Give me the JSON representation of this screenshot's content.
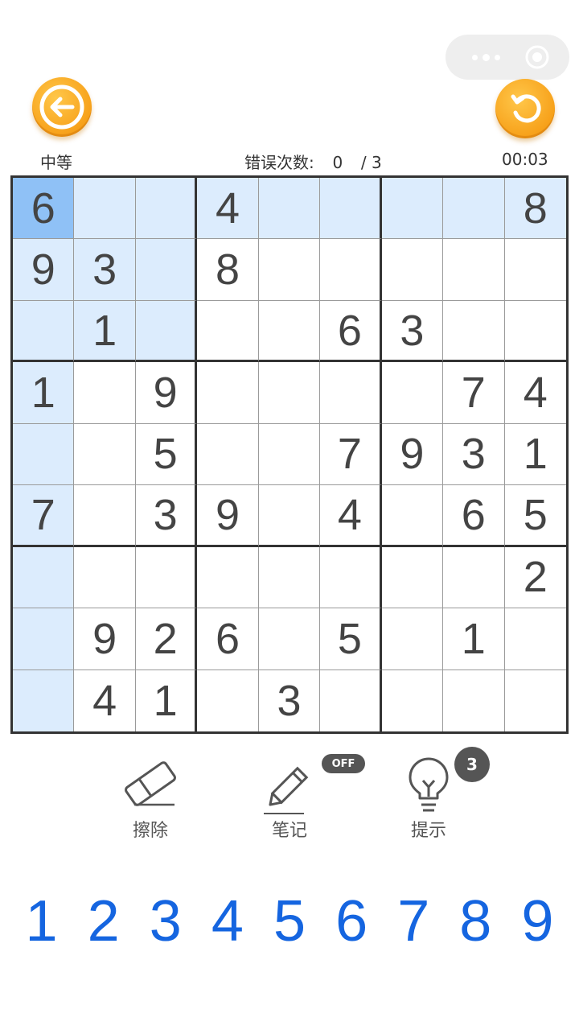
{
  "header": {
    "difficulty": "中等",
    "mistakes_label": "错误次数:",
    "mistakes_count": "0",
    "mistakes_max": "/ 3",
    "timer": "00:03"
  },
  "colors": {
    "highlight": "#dcecfd",
    "selected": "#8fc1f6",
    "number_pad": "#1565e0",
    "action_button": "#f7a11a"
  },
  "icons": {
    "back": "arrow-left-icon",
    "reset": "refresh-icon",
    "more": "more-dots-icon",
    "close": "target-close-icon",
    "erase": "eraser-icon",
    "note": "pencil-icon",
    "hint": "lightbulb-icon"
  },
  "board": {
    "rows": [
      [
        "6",
        "",
        "",
        "4",
        "",
        "",
        "",
        "",
        "8"
      ],
      [
        "9",
        "3",
        "",
        "8",
        "",
        "",
        "",
        "",
        ""
      ],
      [
        "",
        "1",
        "",
        "",
        "",
        "6",
        "3",
        "",
        ""
      ],
      [
        "1",
        "",
        "9",
        "",
        "",
        "",
        "",
        "7",
        "4"
      ],
      [
        "",
        "",
        "5",
        "",
        "",
        "7",
        "9",
        "3",
        "1"
      ],
      [
        "7",
        "",
        "3",
        "9",
        "",
        "4",
        "",
        "6",
        "5"
      ],
      [
        "",
        "",
        "",
        "",
        "",
        "",
        "",
        "",
        "2"
      ],
      [
        "",
        "9",
        "2",
        "6",
        "",
        "5",
        "",
        "1",
        ""
      ],
      [
        "",
        "4",
        "1",
        "",
        "3",
        "",
        "",
        "",
        ""
      ]
    ],
    "selected": {
      "row": 1,
      "col": 1
    }
  },
  "tools": {
    "erase_label": "擦除",
    "note_label": "笔记",
    "note_state": "OFF",
    "hint_label": "提示",
    "hint_count": "3"
  },
  "numpad": [
    "1",
    "2",
    "3",
    "4",
    "5",
    "6",
    "7",
    "8",
    "9"
  ]
}
